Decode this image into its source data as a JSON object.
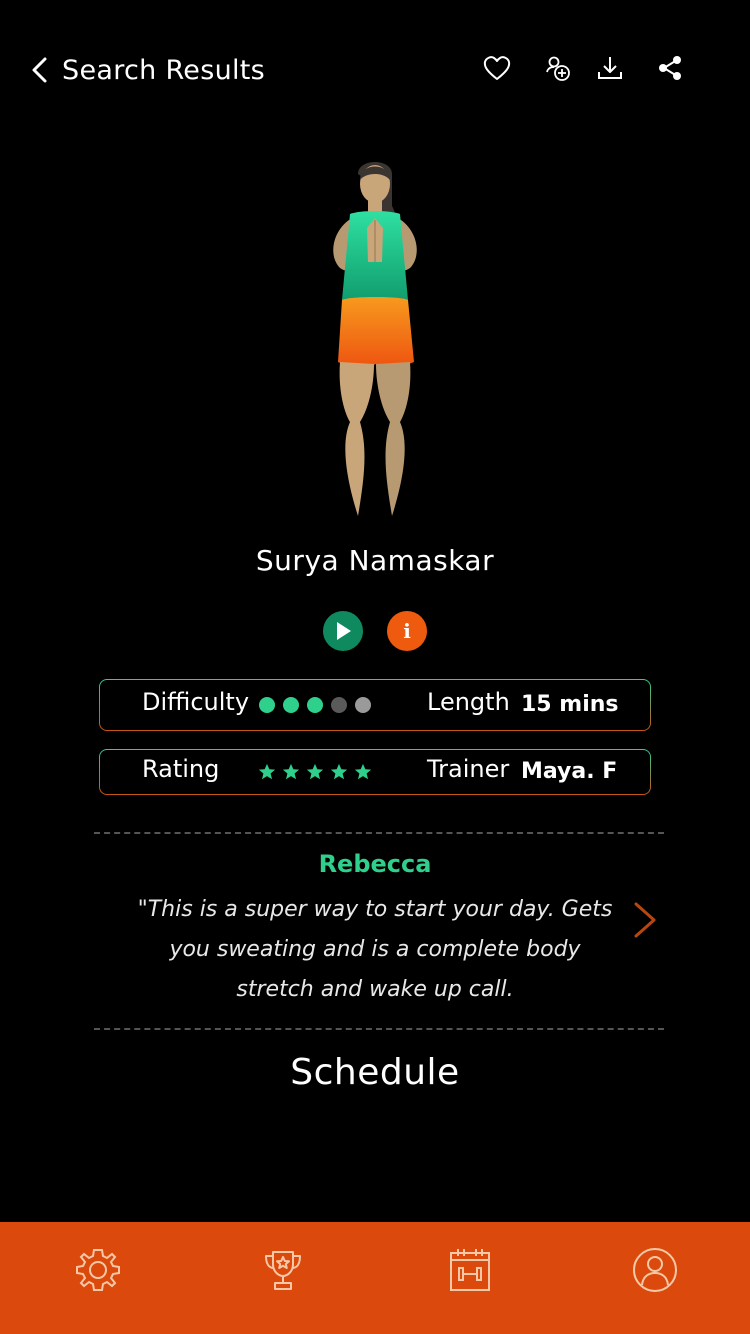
{
  "header": {
    "back_label": "Search Results",
    "icons": [
      "heart-icon",
      "add-user-icon",
      "download-icon",
      "share-icon"
    ]
  },
  "workout": {
    "title": "Surya Namaskar"
  },
  "stats": {
    "difficulty_label": "Difficulty",
    "difficulty_level": 3,
    "difficulty_max": 5,
    "length_label": "Length",
    "length_value": "15 mins",
    "rating_label": "Rating",
    "rating_stars": 5,
    "trainer_label": "Trainer",
    "trainer_value": "Maya. F"
  },
  "review": {
    "reviewer": "Rebecca",
    "text": "\"This is a super way to start your day. Gets you sweating and is a complete body stretch and wake up call."
  },
  "schedule_label": "Schedule",
  "colors": {
    "accent_green": "#2fd08c",
    "accent_orange": "#db4a0c",
    "play_green": "#0f8a5f",
    "info_orange": "#ee5a0e"
  },
  "tabbar": {
    "items": [
      "gear-icon",
      "trophy-icon",
      "calendar-workout-icon",
      "profile-icon"
    ]
  }
}
